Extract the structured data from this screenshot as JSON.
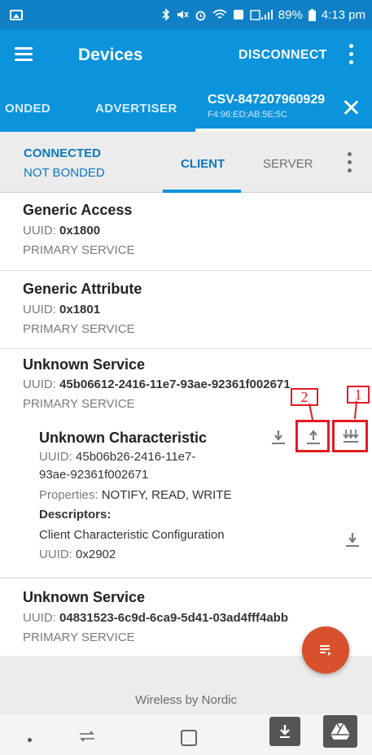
{
  "status_bar": {
    "battery": "89%",
    "time": "4:13 pm"
  },
  "app_bar": {
    "title": "Devices",
    "disconnect_label": "DISCONNECT"
  },
  "device_tabs": {
    "tabs": [
      "ONDED",
      "ADVERTISER"
    ],
    "device_name": "CSV-847207960929",
    "device_mac": "F4:96:ED:AB:5E:5C"
  },
  "sub_bar": {
    "connection_state": "CONNECTED",
    "bond_state": "NOT BONDED",
    "tab_client": "CLIENT",
    "tab_server": "SERVER"
  },
  "services": [
    {
      "title": "Generic Access",
      "uuid_label": "UUID:",
      "uuid": "0x1800",
      "type": "PRIMARY SERVICE"
    },
    {
      "title": "Generic Attribute",
      "uuid_label": "UUID:",
      "uuid": "0x1801",
      "type": "PRIMARY SERVICE"
    },
    {
      "title": "Unknown Service",
      "uuid_label": "UUID:",
      "uuid": "45b06612-2416-11e7-93ae-92361f002671",
      "type": "PRIMARY SERVICE",
      "characteristic": {
        "title": "Unknown Characteristic",
        "uuid_label": "UUID:",
        "uuid_line1": "45b06b26-2416-11e7-",
        "uuid_line2": "93ae-92361f002671",
        "properties_label": "Properties:",
        "properties": "NOTIFY, READ, WRITE",
        "descriptors_label": "Descriptors:",
        "descriptor_name": "Client Characteristic Configuration",
        "descriptor_uuid_label": "UUID:",
        "descriptor_uuid": "0x2902"
      },
      "annotations": [
        "2",
        "1"
      ]
    },
    {
      "title": "Unknown Service",
      "uuid_label": "UUID:",
      "uuid": "04831523-6c9d-6ca9-5d41-03ad4fff4abb",
      "type": "PRIMARY SERVICE"
    }
  ],
  "footer": {
    "text": "Wireless by Nordic"
  },
  "colors": {
    "primary": "#0b93dc",
    "status_bar": "#0f80c6",
    "accent_fab": "#d8512c",
    "annotation_red": "#e31b23"
  },
  "icons": [
    "image-icon",
    "bluetooth-icon",
    "mute-icon",
    "alarm-icon",
    "wifi-icon",
    "signal-icon",
    "battery-icon",
    "menu-icon",
    "more-vert-icon",
    "close-icon",
    "download-icon",
    "upload-icon",
    "notify-icon",
    "list-icon",
    "recent-apps-icon",
    "home-icon",
    "back-icon",
    "drive-icon"
  ]
}
